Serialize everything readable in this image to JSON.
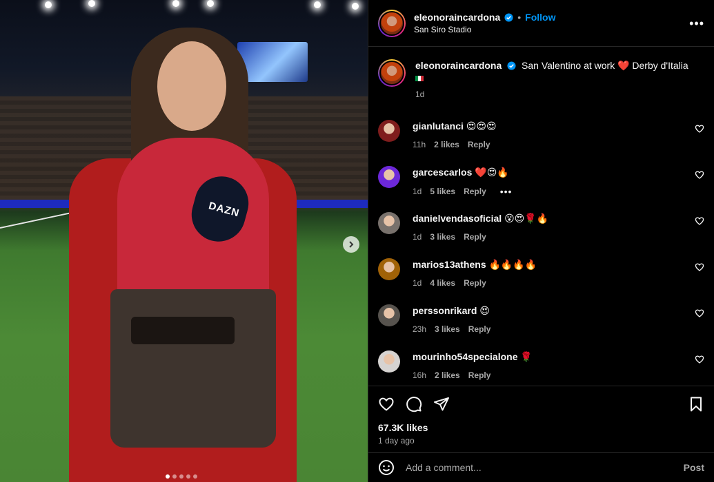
{
  "post": {
    "username": "eleonoraincardona",
    "follow_label": "Follow",
    "separator": "•",
    "location": "San Siro Stadio",
    "more_label": "•••"
  },
  "media": {
    "mic_label": "DAZN",
    "carousel": {
      "count": 5,
      "active": 0
    }
  },
  "caption": {
    "username": "eleonoraincardona",
    "text": "San Valentino at work ❤️ Derby d'Italia",
    "time": "1d"
  },
  "comments": [
    {
      "username": "gianlutanci",
      "text": "😍😍😍",
      "time": "11h",
      "likes": "2 likes",
      "reply": "Reply",
      "avatar_color": "#7f1d1d"
    },
    {
      "username": "garcescarlos",
      "text": "❤️😍🔥",
      "time": "1d",
      "likes": "5 likes",
      "reply": "Reply",
      "more": "•••",
      "avatar_color": "#6d28d9"
    },
    {
      "username": "danielvendasoficial",
      "text": "😮😍🌹🔥",
      "time": "1d",
      "likes": "3 likes",
      "reply": "Reply",
      "avatar_color": "#78716c"
    },
    {
      "username": "marios13athens",
      "text": "🔥🔥🔥🔥",
      "time": "1d",
      "likes": "4 likes",
      "reply": "Reply",
      "avatar_color": "#a16207"
    },
    {
      "username": "perssonrikard",
      "text": "😍",
      "time": "23h",
      "likes": "3 likes",
      "reply": "Reply",
      "avatar_color": "#57534e"
    },
    {
      "username": "mourinho54specialone",
      "text": "🌹",
      "time": "16h",
      "likes": "2 likes",
      "reply": "Reply",
      "avatar_color": "#d6d3d1"
    }
  ],
  "stats": {
    "likes": "67.3K likes",
    "posted": "1 day ago"
  },
  "composer": {
    "placeholder": "Add a comment...",
    "post_label": "Post"
  },
  "colors": {
    "accent": "#0095f6",
    "background": "#000000",
    "muted": "#a8a8a8"
  }
}
